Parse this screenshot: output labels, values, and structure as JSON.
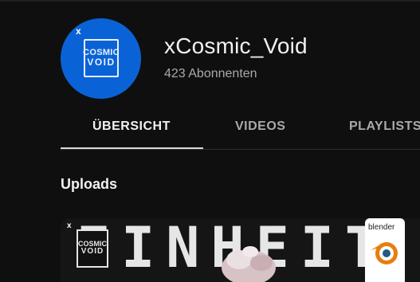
{
  "channel": {
    "name": "xCosmic_Void",
    "subscribers": "423 Abonnenten",
    "avatar": {
      "mark": "x",
      "logo_line1": "COSMIC",
      "logo_line2": "VOID",
      "color": "#0a63d6"
    }
  },
  "tabs": [
    {
      "label": "ÜBERSICHT",
      "active": true
    },
    {
      "label": "VIDEOS",
      "active": false
    },
    {
      "label": "PLAYLISTS",
      "active": false
    }
  ],
  "section": {
    "title": "Uploads"
  },
  "video": {
    "thumbnail_text": "EINHEIT L'D",
    "badge": "blender",
    "logo_mark": "x",
    "logo_line1": "COSMIC",
    "logo_line2": "VOID"
  }
}
